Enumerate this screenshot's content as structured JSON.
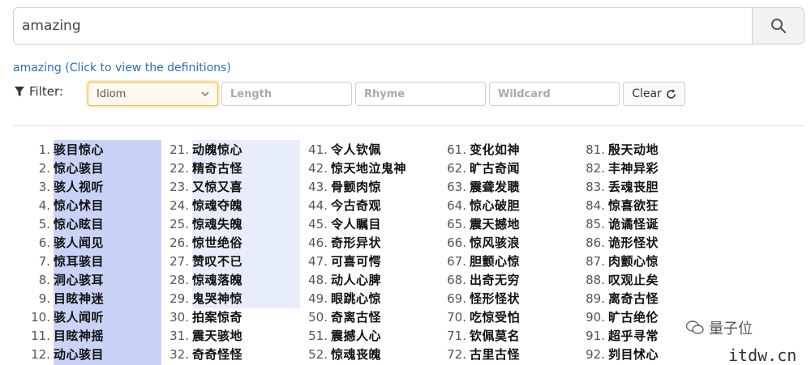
{
  "search": {
    "value": "amazing",
    "button_icon": "search-icon"
  },
  "definitions_link": "amazing (Click to view the definitions)",
  "filter": {
    "label": "Filter:",
    "select_value": "Idiom",
    "length_placeholder": "Length",
    "rhyme_placeholder": "Rhyme",
    "wildcard_placeholder": "Wildcard",
    "clear_label": "Clear"
  },
  "colors": {
    "link": "#2a6dbb",
    "highlight": "#c9d3f6",
    "select_border": "#f0b84a"
  },
  "results": [
    [
      {
        "n": "1.",
        "w": "骇目惊心"
      },
      {
        "n": "2.",
        "w": "惊心骇目"
      },
      {
        "n": "3.",
        "w": "骇人视听"
      },
      {
        "n": "4.",
        "w": "惊心怵目"
      },
      {
        "n": "5.",
        "w": "惊心眩目"
      },
      {
        "n": "6.",
        "w": "骇人闻见"
      },
      {
        "n": "7.",
        "w": "惊耳骇目"
      },
      {
        "n": "8.",
        "w": "洞心骇耳"
      },
      {
        "n": "9.",
        "w": "目眩神迷"
      },
      {
        "n": "10.",
        "w": "骇人闻听"
      },
      {
        "n": "11.",
        "w": "目眩神摇"
      },
      {
        "n": "12.",
        "w": "动心骇目"
      }
    ],
    [
      {
        "n": "21.",
        "w": "动魄惊心"
      },
      {
        "n": "22.",
        "w": "精奇古怪"
      },
      {
        "n": "23.",
        "w": "又惊又喜"
      },
      {
        "n": "24.",
        "w": "惊魂夺魄"
      },
      {
        "n": "25.",
        "w": "惊魂失魄"
      },
      {
        "n": "26.",
        "w": "惊世绝俗"
      },
      {
        "n": "27.",
        "w": "赞叹不已"
      },
      {
        "n": "28.",
        "w": "惊魂落魄"
      },
      {
        "n": "29.",
        "w": "鬼哭神惊"
      },
      {
        "n": "30.",
        "w": "拍案惊奇"
      },
      {
        "n": "31.",
        "w": "震天骇地"
      },
      {
        "n": "32.",
        "w": "奇奇怪怪"
      }
    ],
    [
      {
        "n": "41.",
        "w": "令人钦佩"
      },
      {
        "n": "42.",
        "w": "惊天地泣鬼神"
      },
      {
        "n": "43.",
        "w": "骨颤肉惊"
      },
      {
        "n": "44.",
        "w": "今古奇观"
      },
      {
        "n": "45.",
        "w": "令人瞩目"
      },
      {
        "n": "46.",
        "w": "奇形异状"
      },
      {
        "n": "47.",
        "w": "可喜可愕"
      },
      {
        "n": "48.",
        "w": "动人心脾"
      },
      {
        "n": "49.",
        "w": "眼跳心惊"
      },
      {
        "n": "50.",
        "w": "奇离古怪"
      },
      {
        "n": "51.",
        "w": "震撼人心"
      },
      {
        "n": "52.",
        "w": "惊魂丧魄"
      }
    ],
    [
      {
        "n": "61.",
        "w": "变化如神"
      },
      {
        "n": "62.",
        "w": "旷古奇闻"
      },
      {
        "n": "63.",
        "w": "震聋发聩"
      },
      {
        "n": "64.",
        "w": "惊心破胆"
      },
      {
        "n": "65.",
        "w": "震天撼地"
      },
      {
        "n": "66.",
        "w": "惊风骇浪"
      },
      {
        "n": "67.",
        "w": "胆颤心惊"
      },
      {
        "n": "68.",
        "w": "出奇无穷"
      },
      {
        "n": "69.",
        "w": "怪形怪状"
      },
      {
        "n": "70.",
        "w": "吃惊受怕"
      },
      {
        "n": "71.",
        "w": "钦佩莫名"
      },
      {
        "n": "72.",
        "w": "古里古怪"
      }
    ],
    [
      {
        "n": "81.",
        "w": "殷天动地"
      },
      {
        "n": "82.",
        "w": "丰神异彩"
      },
      {
        "n": "83.",
        "w": "丢魂丧胆"
      },
      {
        "n": "84.",
        "w": "惊喜欲狂"
      },
      {
        "n": "85.",
        "w": "诡谲怪诞"
      },
      {
        "n": "86.",
        "w": "诡形怪状"
      },
      {
        "n": "87.",
        "w": "肉颤心惊"
      },
      {
        "n": "88.",
        "w": "叹观止矣"
      },
      {
        "n": "89.",
        "w": "离奇古怪"
      },
      {
        "n": "90.",
        "w": "旷古绝伦"
      },
      {
        "n": "91.",
        "w": "超乎寻常"
      },
      {
        "n": "92.",
        "w": "刿目怵心"
      }
    ]
  ],
  "watermark": "量子位",
  "site_mark": "itdw.cn"
}
